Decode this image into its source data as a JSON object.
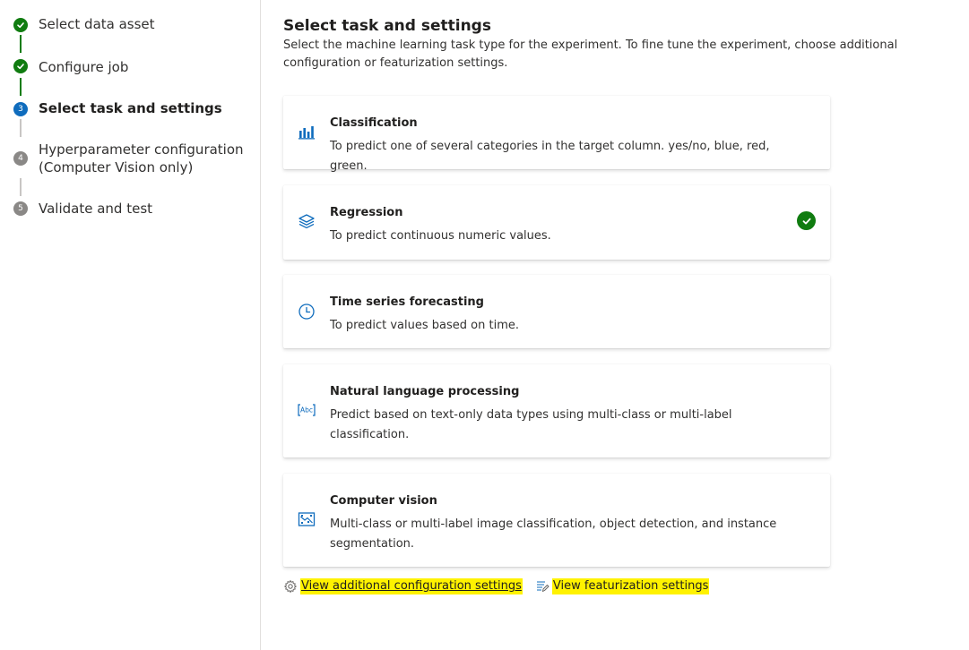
{
  "steps": [
    {
      "number": "1",
      "label": "Select data asset",
      "state": "done"
    },
    {
      "number": "2",
      "label": "Configure job",
      "state": "done"
    },
    {
      "number": "3",
      "label": "Select task and settings",
      "state": "active"
    },
    {
      "number": "4",
      "label": "Hyperparameter configuration (Computer Vision only)",
      "state": "todo"
    },
    {
      "number": "5",
      "label": "Validate and test",
      "state": "todo"
    }
  ],
  "main": {
    "title": "Select task and settings",
    "description": "Select the machine learning task type for the experiment. To fine tune the experiment, choose additional configuration or featurization settings."
  },
  "tasks": [
    {
      "title": "Classification",
      "description": "To predict one of several categories in the target column. yes/no, blue, red, green.",
      "icon": "bar-chart-icon",
      "selected": false
    },
    {
      "title": "Regression",
      "description": "To predict continuous numeric values.",
      "icon": "layers-icon",
      "selected": true
    },
    {
      "title": "Time series forecasting",
      "description": "To predict values based on time.",
      "icon": "clock-icon",
      "selected": false
    },
    {
      "title": "Natural language processing",
      "description": "Predict based on text-only data types using multi-class or multi-label classification.",
      "icon": "text-abc-icon",
      "selected": false
    },
    {
      "title": "Computer vision",
      "description": "Multi-class or multi-label image classification, object detection, and instance segmentation.",
      "icon": "image-icon",
      "selected": false
    }
  ],
  "links": {
    "additional_config": "View additional configuration settings",
    "featurization": "View featurization settings"
  },
  "colors": {
    "done": "#107c10",
    "active": "#0f6cbd",
    "todo": "#8a8886",
    "highlight": "#fff200",
    "accent": "#0f6cbd"
  }
}
